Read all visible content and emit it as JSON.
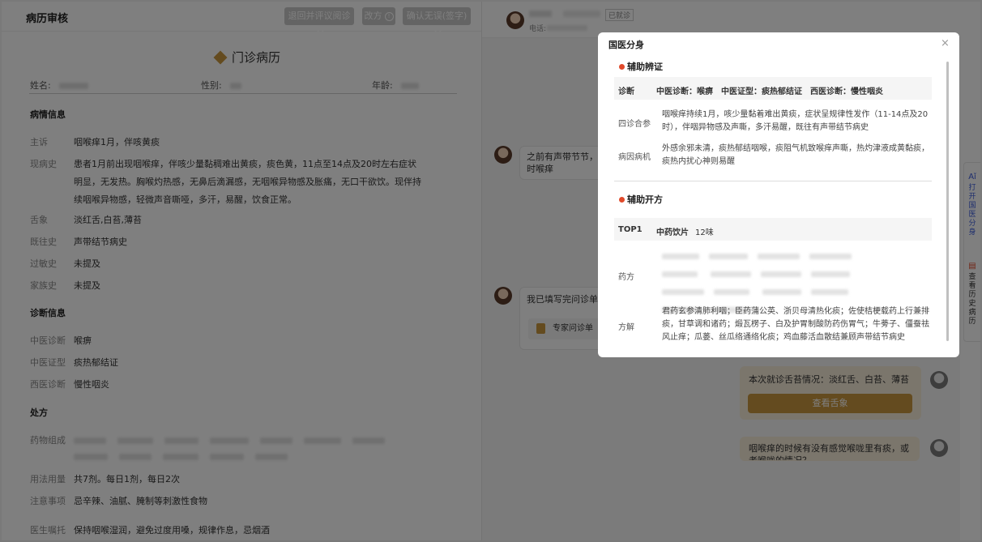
{
  "left": {
    "title": "病历审核",
    "buttons": [
      {
        "label": "退回并评议阅诊",
        "icon": "info-icon"
      },
      {
        "label": "改方",
        "icon": "info-icon"
      },
      {
        "label": "确认无误(签字)",
        "icon": "info-icon"
      }
    ],
    "record_title": "门诊病历",
    "patient": {
      "name_label": "姓名:",
      "gender_label": "性别:",
      "age_label": "年龄:"
    },
    "sections": {
      "condition": "病情信息",
      "diagnosis": "诊断信息",
      "prescription": "处方"
    },
    "condition": {
      "complaint_label": "主诉",
      "complaint": "咽喉痒1月，伴咳黄痰",
      "present_label": "现病史",
      "present": "患者1月前出现咽喉痒，伴咳少量黏稠难出黄痰，痰色黄，11点至14点及20时左右症状明显，无发热。胸喉灼热感，无鼻后滴漏感，无咽喉异物感及胀痛，无口干欲饮。现伴持续咽喉异物感，轻微声音嘶哑，多汗，易醒，饮食正常。",
      "tongue_label": "舌象",
      "tongue": "淡红舌,白苔,薄苔",
      "past_label": "既往史",
      "past": "声带结节病史",
      "allergy_label": "过敏史",
      "allergy": "未提及",
      "family_label": "家族史",
      "family": "未提及"
    },
    "diagnosis": {
      "tcm_label": "中医诊断",
      "tcm": "喉痹",
      "syndrome_label": "中医证型",
      "syndrome": "痰热郁结证",
      "western_label": "西医诊断",
      "western": "慢性咽炎"
    },
    "prescription": {
      "herbs_label": "药物组成",
      "usage_label": "用法用量",
      "usage": "共7剂。每日1剂，每日2次",
      "notes_label": "注意事项",
      "notes": "忌辛辣、油腻、腌制等刺激性食物",
      "advice_label": "医生嘱托",
      "advice": "保持咽喉湿润，避免过度用嗓，规律作息，忌烟酒"
    }
  },
  "chat": {
    "header_tag": "已就诊",
    "header_phone_label": "电话:",
    "msg1": "之前有声带节节，发作时喉痒",
    "msg2": "我已填写完问诊单，",
    "msg2_card": "专家问诊单",
    "msg3": "本次就诊舌苔情况：淡红舌、白苔、薄苔",
    "msg3_button": "查看舌象",
    "msg4": "咽喉痒的时候有没有感觉喉咙里有痰，或者喉咙的情况？"
  },
  "float_menu": {
    "open_label": "打开国医分身",
    "history_label": "查看历史病历"
  },
  "modal": {
    "title": "国医分身",
    "close": "×",
    "section1": "辅助辨证",
    "diag_label": "诊断",
    "diag_value": "中医诊断：喉痹　中医证型：痰热郁结证　西医诊断：慢性咽炎",
    "sizhen_label": "四诊合参",
    "sizhen_value": "咽喉痒持续1月，咳少量黏着难出黄痰，症状呈规律性发作（11-14点及20时），伴咽异物感及声嘶，多汗易醒，既往有声带结节病史",
    "bingyin_label": "病因病机",
    "bingyin_value": "外感余邪未清，痰热郁结咽喉，痰阻气机致喉痒声嘶，热灼津液成黄黏痰，痰热内扰心神则易醒",
    "section2": "辅助开方",
    "top_label": "TOP1",
    "top_type": "中药饮片",
    "top_count": "12味",
    "yaofang_label": "药方",
    "fangjie_label": "方解",
    "fangjie_value": "君药玄参清肺利咽；臣药蒲公英、浙贝母清热化痰；佐使桔梗载药上行兼排痰，甘草调和诸药；煅瓦楞子、白及护胃制酸防药伤胃气；牛蒡子、僵蚕祛风止痒；瓜蒌、丝瓜络通络化痰；鸡血藤活血散结兼顾声带结节病史"
  }
}
